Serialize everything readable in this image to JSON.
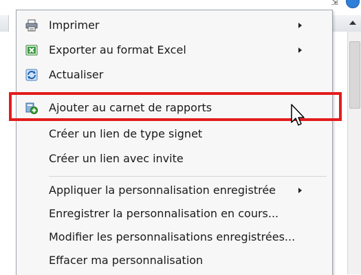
{
  "menu": {
    "items": [
      {
        "label": "Imprimer",
        "icon": "printer-icon",
        "submenu": true
      },
      {
        "label": "Exporter au format Excel",
        "icon": "excel-icon",
        "submenu": true
      },
      {
        "label": "Actualiser",
        "icon": "refresh-icon",
        "submenu": false
      },
      {
        "label": "Ajouter au carnet de rapports",
        "icon": "add-to-briefing-book-icon",
        "submenu": false,
        "highlighted": true
      },
      {
        "label": "Créer un lien de type signet",
        "submenu": false
      },
      {
        "label": "Créer un lien avec invite",
        "submenu": false
      },
      {
        "label": "Appliquer la personnalisation enregistrée",
        "submenu": true
      },
      {
        "label": "Enregistrer la personnalisation en cours...",
        "submenu": false
      },
      {
        "label": "Modifier les personnalisations enregistrées...",
        "submenu": false
      },
      {
        "label": "Effacer ma personnalisation",
        "submenu": false
      }
    ]
  },
  "colors": {
    "highlight_border": "#e41b1b",
    "menu_background": "#f7f7f7",
    "menu_border": "#9da3aa"
  }
}
